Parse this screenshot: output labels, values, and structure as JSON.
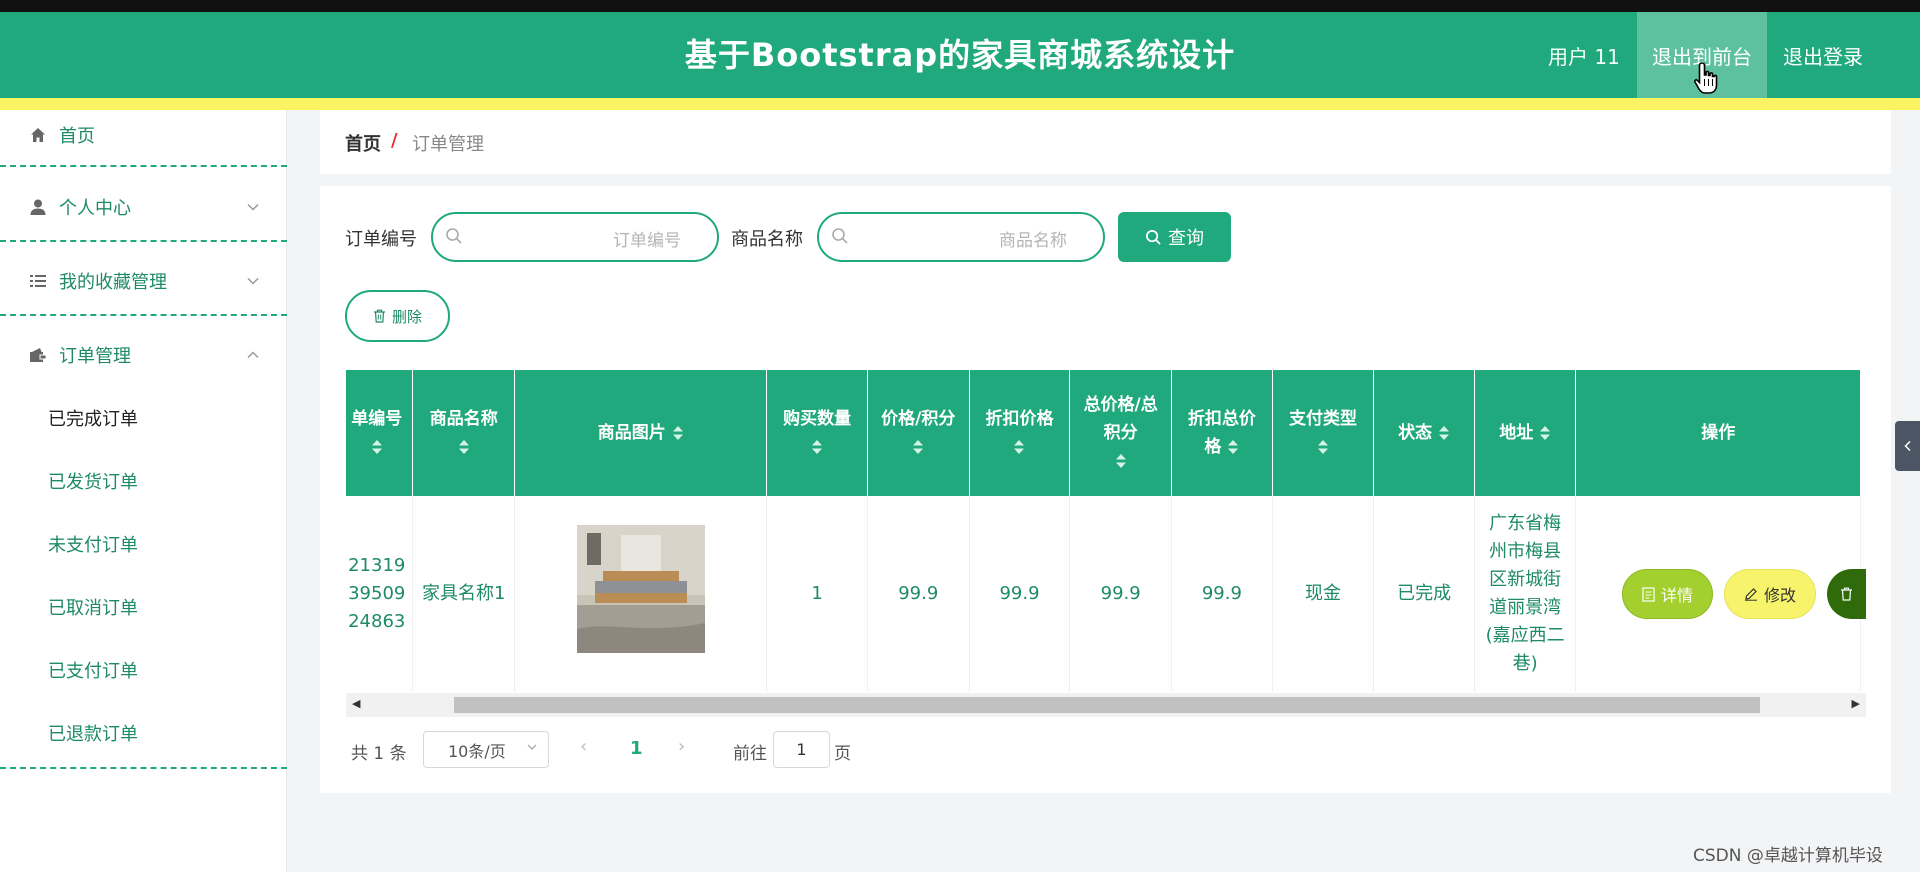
{
  "header": {
    "title": "基于Bootstrap的家具商城系统设计",
    "user": "用户 11",
    "front_link": "退出到前台",
    "logout_link": "退出登录"
  },
  "sidebar": {
    "home": "首页",
    "personal": "个人中心",
    "favorites": "我的收藏管理",
    "orders": "订单管理",
    "sub_items": [
      "已完成订单",
      "已发货订单",
      "未支付订单",
      "已取消订单",
      "已支付订单",
      "已退款订单"
    ]
  },
  "breadcrumb": {
    "home": "首页",
    "separator": "/",
    "current": "订单管理"
  },
  "filters": {
    "order_no_label": "订单编号",
    "order_no_placeholder": "订单编号",
    "product_label": "商品名称",
    "product_placeholder": "商品名称",
    "query_button": "查询",
    "delete_button": "删除"
  },
  "table": {
    "headers": [
      "单编号",
      "商品名称",
      "商品图片",
      "购买数量",
      "价格/积分",
      "折扣价格",
      "总价格/总积分",
      "折扣总价格",
      "支付类型",
      "状态",
      "地址",
      "操作"
    ],
    "row": {
      "order_no": "21319 39509 24863",
      "product": "家具名称1",
      "quantity": "1",
      "price": "99.9",
      "discount_price": "99.9",
      "total": "99.9",
      "discount_total": "99.9",
      "pay_type": "现金",
      "status": "已完成",
      "address": "广东省梅州市梅县区新城街道丽景湾(嘉应西二巷)"
    },
    "actions": {
      "detail": "详情",
      "edit": "修改"
    }
  },
  "pagination": {
    "total": "共 1 条",
    "page_size": "10条/页",
    "current_page": "1",
    "goto_label": "前往",
    "goto_value": "1",
    "page_suffix": "页"
  },
  "watermark": "CSDN @卓越计算机毕设",
  "colors": {
    "primary": "#1fa97c",
    "accent_yellow": "#fbf264",
    "detail_btn": "#a3cf2f",
    "edit_btn": "#f7f46b",
    "delete_btn": "#2f6b0a"
  }
}
